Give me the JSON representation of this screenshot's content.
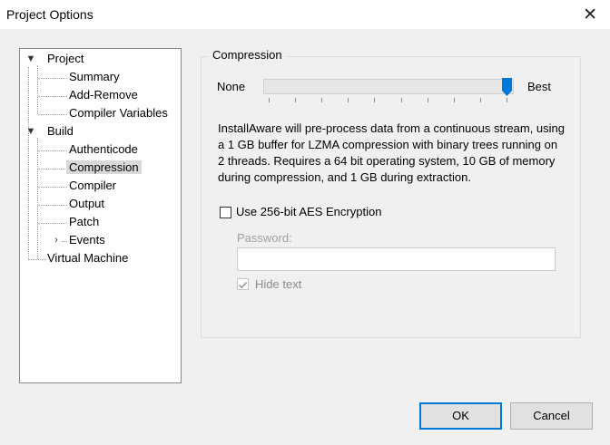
{
  "window": {
    "title": "Project Options",
    "close_glyph": "✕"
  },
  "tree": {
    "project": {
      "label": "Project",
      "expander": "expanded"
    },
    "summary": {
      "label": "Summary"
    },
    "add_remove": {
      "label": "Add-Remove"
    },
    "compiler_variables": {
      "label": "Compiler Variables"
    },
    "build": {
      "label": "Build",
      "expander": "expanded"
    },
    "authenticode": {
      "label": "Authenticode"
    },
    "compression": {
      "label": "Compression",
      "selected": true
    },
    "compiler": {
      "label": "Compiler"
    },
    "output": {
      "label": "Output"
    },
    "patch": {
      "label": "Patch"
    },
    "events": {
      "label": "Events",
      "expander": "collapsed"
    },
    "virtual_machine": {
      "label": "Virtual Machine"
    }
  },
  "compression": {
    "group_title": "Compression",
    "slider": {
      "min_label": "None",
      "max_label": "Best",
      "level": 1.0,
      "ticks": 10
    },
    "description": "InstallAware will pre-process data from a continuous stream, using a 1 GB buffer for LZMA compression with binary trees running on 2 threads. Requires a 64 bit operating system, 10 GB of memory during compression, and 1 GB during extraction."
  },
  "encryption": {
    "checkbox_label": "Use 256-bit AES Encryption",
    "checked": false,
    "password_label": "Password:",
    "password_value": "",
    "hide_text_label": "Hide text",
    "hide_text_checked": true,
    "enabled": false
  },
  "buttons": {
    "ok": "OK",
    "cancel": "Cancel"
  },
  "colors": {
    "accent": "#0078d7",
    "selection": "#d9d9d9"
  }
}
